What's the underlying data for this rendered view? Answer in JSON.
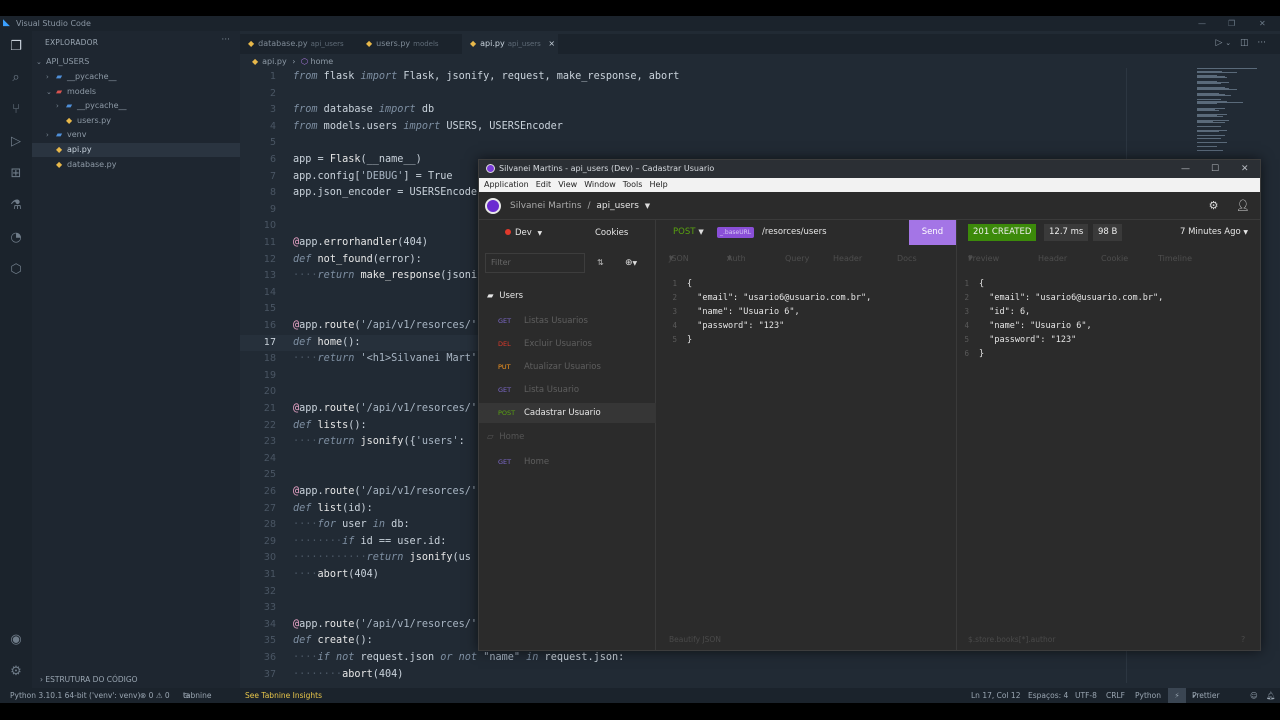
{
  "vscode": {
    "title": "Visual Studio Code",
    "explorer_title": "EXPLORADOR",
    "project": "API_USERS",
    "tree": [
      {
        "label": "__pycache__",
        "type": "folder",
        "chev": "›",
        "depth": 1
      },
      {
        "label": "models",
        "type": "folder-open",
        "chev": "⌄",
        "depth": 1
      },
      {
        "label": "__pycache__",
        "type": "folder",
        "chev": "›",
        "depth": 2
      },
      {
        "label": "users.py",
        "type": "py",
        "chev": "",
        "depth": 2
      },
      {
        "label": "venv",
        "type": "folder",
        "chev": "›",
        "depth": 1
      },
      {
        "label": "api.py",
        "type": "py",
        "chev": "",
        "depth": 1,
        "selected": true
      },
      {
        "label": "database.py",
        "type": "py",
        "chev": "",
        "depth": 1
      }
    ],
    "outline_label": "ESTRUTURA DO CÓDIGO",
    "tabs": [
      {
        "label": "database.py",
        "sub": "api_users"
      },
      {
        "label": "users.py",
        "sub": "models"
      },
      {
        "label": "api.py",
        "sub": "api_users",
        "close": "×"
      }
    ],
    "breadcrumb": {
      "file": "api.py",
      "sep": "›",
      "symbol": "home"
    },
    "code_lines": [
      {
        "n": "1",
        "html": "<span class='kw'>from</span> flask <span class='kw'>import</span> Flask, jsonify, request, make_response, abort"
      },
      {
        "n": "2",
        "html": ""
      },
      {
        "n": "3",
        "html": "<span class='kw'>from</span> database <span class='kw'>import</span> db"
      },
      {
        "n": "4",
        "html": "<span class='kw'>from</span> models.users <span class='kw'>import</span> USERS, USERSEncoder"
      },
      {
        "n": "5",
        "html": ""
      },
      {
        "n": "6",
        "html": "app = <span class='fn'>Flask</span>(__name__)"
      },
      {
        "n": "7",
        "html": "app.config[<span class='str'>'DEBUG'</span>] = True"
      },
      {
        "n": "8",
        "html": "app.json_encoder = USERSEncoder"
      },
      {
        "n": "9",
        "html": ""
      },
      {
        "n": "10",
        "html": ""
      },
      {
        "n": "11",
        "html": "<span class='dec'>@</span>app.<span class='fn'>errorhandler</span>(404)"
      },
      {
        "n": "12",
        "html": "<span class='kw'>def</span> <span class='fn'>not_found</span>(error):"
      },
      {
        "n": "13",
        "html": "<span class='ws'>····</span><span class='kw'>return</span> <span class='fn'>make_response</span>(jsonify"
      },
      {
        "n": "14",
        "html": ""
      },
      {
        "n": "15",
        "html": ""
      },
      {
        "n": "16",
        "html": "<span class='dec'>@</span>app.<span class='fn'>route</span>(<span class='str'>'/api/v1/resorces/'</span>"
      },
      {
        "n": "17",
        "html": "<span class='kw'>def</span> <span class='fn'>home</span>():",
        "current": true
      },
      {
        "n": "18",
        "html": "<span class='ws'>····</span><span class='kw'>return</span> <span class='str'>'&lt;h1&gt;Silvanei Mart'</span>"
      },
      {
        "n": "19",
        "html": ""
      },
      {
        "n": "20",
        "html": ""
      },
      {
        "n": "21",
        "html": "<span class='dec'>@</span>app.<span class='fn'>route</span>(<span class='str'>'/api/v1/resorces/'</span>"
      },
      {
        "n": "22",
        "html": "<span class='kw'>def</span> <span class='fn'>lists</span>():"
      },
      {
        "n": "23",
        "html": "<span class='ws'>····</span><span class='kw'>return</span> <span class='fn'>jsonify</span>({<span class='str'>'users'</span>:"
      },
      {
        "n": "24",
        "html": ""
      },
      {
        "n": "25",
        "html": ""
      },
      {
        "n": "26",
        "html": "<span class='dec'>@</span>app.<span class='fn'>route</span>(<span class='str'>'/api/v1/resorces/'</span>"
      },
      {
        "n": "27",
        "html": "<span class='kw'>def</span> <span class='fn'>list</span>(id):"
      },
      {
        "n": "28",
        "html": "<span class='ws'>····</span><span class='kw'>for</span> user <span class='kw'>in</span> db:"
      },
      {
        "n": "29",
        "html": "<span class='ws'>········</span><span class='kw'>if</span> id == user.id:"
      },
      {
        "n": "30",
        "html": "<span class='ws'>············</span><span class='kw'>return</span> <span class='fn'>jsonify</span>(us"
      },
      {
        "n": "31",
        "html": "<span class='ws'>····</span><span class='fn'>abort</span>(404)"
      },
      {
        "n": "32",
        "html": ""
      },
      {
        "n": "33",
        "html": ""
      },
      {
        "n": "34",
        "html": "<span class='dec'>@</span>app.<span class='fn'>route</span>(<span class='str'>'/api/v1/resorces/'</span>"
      },
      {
        "n": "35",
        "html": "<span class='kw'>def</span> <span class='fn'>create</span>():"
      },
      {
        "n": "36",
        "html": "<span class='ws'>····</span><span class='kw'>if not</span> request.json <span class='kw'>or not</span> <span class='str'>\"name\"</span> <span class='kw'>in</span> request.json:"
      },
      {
        "n": "37",
        "html": "<span class='ws'>········</span><span class='fn'>abort</span>(404)"
      }
    ],
    "status": {
      "python": "Python 3.10.1 64-bit ('venv': venv)",
      "problems": "⊗ 0 ⚠ 0",
      "tabnine": "tabnine",
      "insights": "See Tabnine Insights",
      "position": "Ln 17, Col 12",
      "spaces": "Espaços: 4",
      "encoding": "UTF-8",
      "eol": "CRLF",
      "language": "Python",
      "prettier": "Prettier"
    }
  },
  "insomnia": {
    "window_title": "Silvanei Martins - api_users (Dev) – Cadastrar Usuario",
    "menu": [
      "Application",
      "Edit",
      "View",
      "Window",
      "Tools",
      "Help"
    ],
    "breadcrumb_org": "Silvanei Martins",
    "breadcrumb_sep": "/",
    "breadcrumb_project": "api_users",
    "environment": "Dev",
    "cookies_label": "Cookies",
    "filter_placeholder": "Filter",
    "folder_users": "Users",
    "requests_users": [
      {
        "method": "GET",
        "cls": "m-get",
        "name": "Listas Usuarios"
      },
      {
        "method": "DEL",
        "cls": "m-del",
        "name": "Excluir Usuarios"
      },
      {
        "method": "PUT",
        "cls": "m-put",
        "name": "Atualizar Usuarios"
      },
      {
        "method": "GET",
        "cls": "m-get",
        "name": "Lista Usuario"
      },
      {
        "method": "POST",
        "cls": "m-post",
        "name": "Cadastrar Usuario",
        "active": true
      }
    ],
    "folder_home": "Home",
    "requests_home": [
      {
        "method": "GET",
        "cls": "m-get",
        "name": "Home"
      }
    ],
    "request": {
      "method": "POST",
      "base_var": "_.baseURL",
      "path": "/resorces/users",
      "send_label": "Send",
      "tabs": [
        "JSON",
        "Auth",
        "Query",
        "Header",
        "Docs"
      ],
      "body_lines": [
        {
          "n": "1",
          "text": "{"
        },
        {
          "n": "2",
          "text": "  \"email\": \"usario6@usuario.com.br\","
        },
        {
          "n": "3",
          "text": "  \"name\": \"Usuario 6\","
        },
        {
          "n": "4",
          "text": "  \"password\": \"123\""
        },
        {
          "n": "5",
          "text": "}"
        }
      ],
      "beautify_label": "Beautify JSON"
    },
    "response": {
      "status": "201 CREATED",
      "time": "12.7 ms",
      "size": "98 B",
      "ago": "7 Minutes Ago",
      "tabs": [
        "Preview",
        "Header",
        "Cookie",
        "Timeline"
      ],
      "body_lines": [
        {
          "n": "1",
          "text": "{"
        },
        {
          "n": "2",
          "text": "  \"email\": \"usario6@usuario.com.br\","
        },
        {
          "n": "3",
          "text": "  \"id\": 6,"
        },
        {
          "n": "4",
          "text": "  \"name\": \"Usuario 6\","
        },
        {
          "n": "5",
          "text": "  \"password\": \"123\""
        },
        {
          "n": "6",
          "text": "}"
        }
      ],
      "filter_placeholder": "$.store.books[*].author"
    }
  }
}
